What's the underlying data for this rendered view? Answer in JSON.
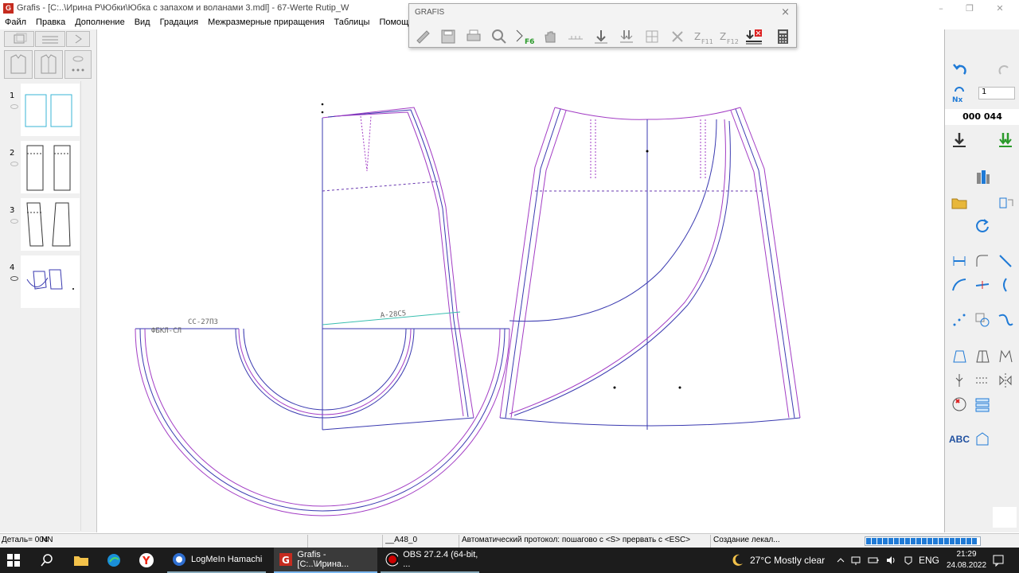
{
  "window": {
    "app_logo": "G",
    "title": "Grafis - [C:..\\Ирина Р\\Юбки\\Юбка с запахом и воланами 3.mdl] - 67-Werte Rutip_W"
  },
  "menu": {
    "items": [
      "Файл",
      "Правка",
      "Дополнение",
      "Вид",
      "Градация",
      "Межразмерные приращения",
      "Таблицы",
      "Помощь"
    ]
  },
  "left_panel": {
    "thumbnails": [
      {
        "num": "1"
      },
      {
        "num": "2"
      },
      {
        "num": "3"
      },
      {
        "num": "4"
      }
    ]
  },
  "floating_toolbar": {
    "title": "GRAFIS",
    "close": "×",
    "labels": {
      "f6": "F6",
      "f11": "F11",
      "f12": "F12"
    }
  },
  "canvas": {
    "labels": {
      "label_a": "СС-27ПЗ",
      "label_b": "ФБКЛ-СЛ",
      "label_c": "А-28С5"
    }
  },
  "right_panel": {
    "nx_value": "1",
    "counter": "000 044",
    "abc_label": "ABC"
  },
  "status": {
    "detail": "Деталь= 004",
    "nn": "NN",
    "size": "__A48_0",
    "protocol": "Автоматический протокол: пошагово с <S> прервать с <ESC>",
    "action": "Создание лекал..."
  },
  "taskbar": {
    "apps": [
      "LogMeIn Hamachi",
      "Grafis - [C:..\\Ирина...",
      "OBS 27.2.4 (64-bit, ..."
    ],
    "weather": "27°C  Mostly clear",
    "lang": "ENG",
    "time": "21:29",
    "date": "24.08.2022"
  },
  "colors": {
    "accent": "#1f7ad6",
    "pattern_purple": "#a23cc4",
    "pattern_blue": "#3a3ab0",
    "thumb_cyan": "#39b6d6"
  }
}
